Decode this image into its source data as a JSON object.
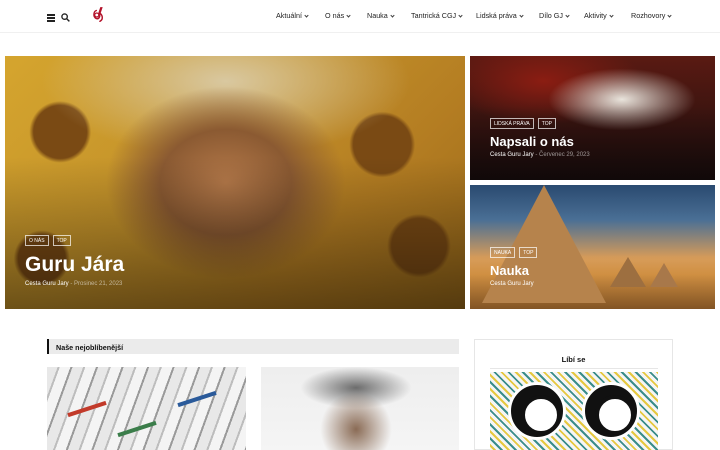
{
  "header": {
    "menu_icon": "hamburger-icon",
    "search_icon": "search-icon",
    "logo_icon": "brand-logo-icon",
    "nav": [
      {
        "label": "Aktuální"
      },
      {
        "label": "O nás"
      },
      {
        "label": "Nauka"
      },
      {
        "label": "Tantrická CGJ"
      },
      {
        "label": "Lidská práva"
      },
      {
        "label": "Dílo GJ"
      },
      {
        "label": "Aktivity"
      },
      {
        "label": "Rozhovory"
      }
    ]
  },
  "hero": {
    "main": {
      "tags": [
        "O nás",
        "TOP"
      ],
      "title": "Guru Jára",
      "author": "Cesta Guru Jary",
      "date": "Prosinec 21, 2023"
    },
    "top": {
      "tags": [
        "Lidská práva",
        "TOP"
      ],
      "title": "Napsali o nás",
      "author": "Cesta Guru Jary",
      "date": "Červenec 29, 2023"
    },
    "bottom": {
      "tags": [
        "Nauka",
        "TOP"
      ],
      "title": "Nauka",
      "author": "Cesta Guru Jary"
    }
  },
  "section": {
    "title": "Naše nejoblíbenější"
  },
  "widget": {
    "title": "Líbí se"
  },
  "colors": {
    "accent": "#b3122a",
    "section_bg": "#ebebeb"
  }
}
